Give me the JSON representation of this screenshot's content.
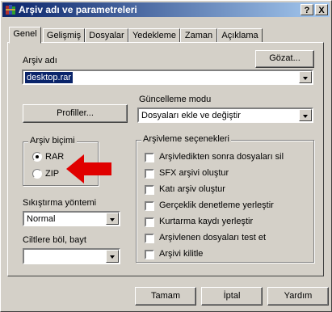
{
  "window": {
    "title": "Arşiv adı ve parametreleri",
    "help_btn": "?",
    "close_btn": "X"
  },
  "tabs": [
    {
      "label": "Genel",
      "active": true
    },
    {
      "label": "Gelişmiş",
      "active": false
    },
    {
      "label": "Dosyalar",
      "active": false
    },
    {
      "label": "Yedekleme",
      "active": false
    },
    {
      "label": "Zaman",
      "active": false
    },
    {
      "label": "Açıklama",
      "active": false
    }
  ],
  "archive_name": {
    "label": "Arşiv adı",
    "value": "desktop.rar",
    "browse_label": "Gözat..."
  },
  "profiles_label": "Profiller...",
  "update_mode": {
    "label": "Güncelleme modu",
    "value": "Dosyaları ekle ve değiştir"
  },
  "archive_format": {
    "label": "Arşiv biçimi",
    "options": [
      {
        "label": "RAR",
        "selected": true
      },
      {
        "label": "ZIP",
        "selected": false
      }
    ]
  },
  "compression": {
    "label": "Sıkıştırma yöntemi",
    "value": "Normal"
  },
  "split_volumes": {
    "label": "Ciltlere böl, bayt",
    "value": ""
  },
  "archive_options": {
    "label": "Arşivleme seçenekleri",
    "items": [
      "Arşivledikten sonra dosyaları sil",
      "SFX arşivi oluştur",
      "Katı arşiv oluştur",
      "Gerçeklik denetleme yerleştir",
      "Kurtarma kaydı yerleştir",
      "Arşivlenen dosyaları test et",
      "Arşivi kilitle"
    ]
  },
  "footer": {
    "ok": "Tamam",
    "cancel": "İptal",
    "help": "Yardım"
  },
  "colors": {
    "titlebar_start": "#0a246a",
    "titlebar_end": "#a6caf0",
    "dialog_bg": "#d4d0c8",
    "arrow": "#e00000"
  }
}
